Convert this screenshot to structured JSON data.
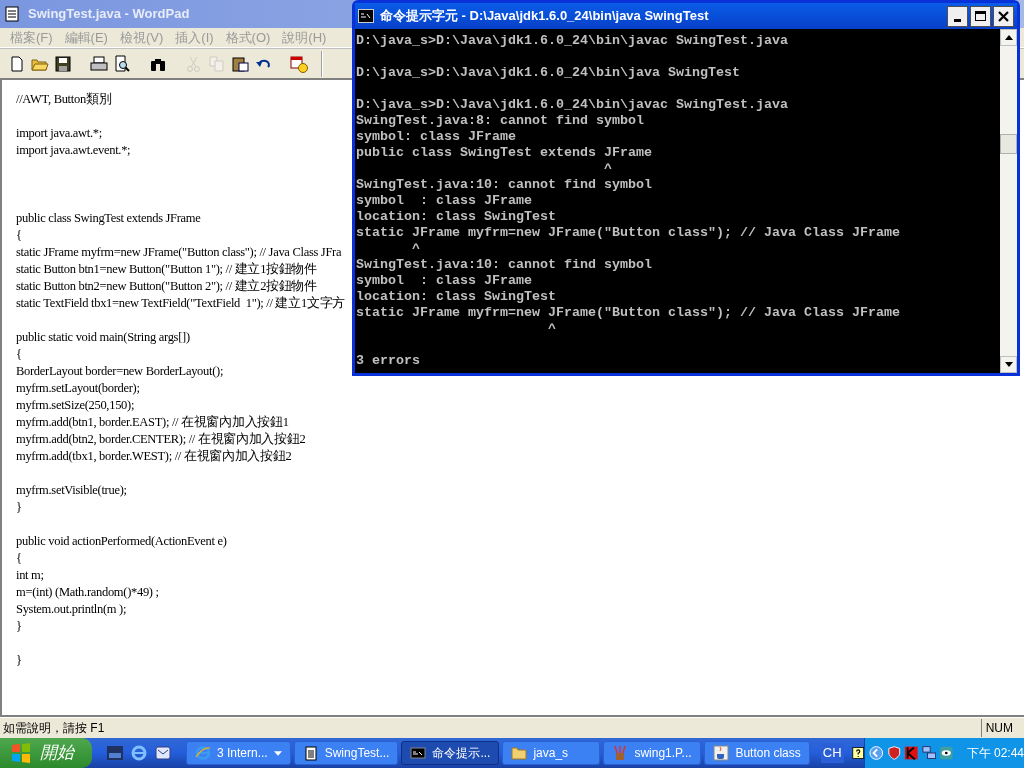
{
  "wordpad": {
    "title": "SwingTest.java - WordPad",
    "menu": [
      {
        "label": "檔案(F)",
        "disabled": true
      },
      {
        "label": "編輯(E)",
        "disabled": true
      },
      {
        "label": "檢視(V)",
        "disabled": true
      },
      {
        "label": "插入(I)",
        "disabled": true
      },
      {
        "label": "格式(O)",
        "disabled": true
      },
      {
        "label": "說明(H)",
        "disabled": true
      }
    ],
    "toolbar": [
      {
        "kind": "new",
        "disabled": false
      },
      {
        "kind": "open",
        "disabled": false
      },
      {
        "kind": "save",
        "disabled": false
      },
      {
        "kind": "separator"
      },
      {
        "kind": "print",
        "disabled": false
      },
      {
        "kind": "preview",
        "disabled": false
      },
      {
        "kind": "separator"
      },
      {
        "kind": "find",
        "disabled": false
      },
      {
        "kind": "separator"
      },
      {
        "kind": "cut",
        "disabled": true
      },
      {
        "kind": "copy",
        "disabled": true
      },
      {
        "kind": "paste",
        "disabled": false
      },
      {
        "kind": "undo",
        "disabled": false
      },
      {
        "kind": "separator"
      },
      {
        "kind": "datetime",
        "disabled": false
      }
    ],
    "lines": [
      {
        "kind": "code",
        "text": "//AWT, Button類別"
      },
      {
        "kind": "blank"
      },
      {
        "kind": "code",
        "text": "import java.awt.*;"
      },
      {
        "kind": "code",
        "text": "import java.awt.event.*;"
      },
      {
        "kind": "blank"
      },
      {
        "kind": "blank"
      },
      {
        "kind": "blank"
      },
      {
        "kind": "code",
        "text": "public class SwingTest extends JFrame"
      },
      {
        "kind": "code",
        "text": "{"
      },
      {
        "kind": "code",
        "text": "static JFrame myfrm=new JFrame(\"Button class\"); // Java Class JFra"
      },
      {
        "kind": "code",
        "text": "static Button btn1=new Button(\"Button 1\"); // 建立1按鈕物件"
      },
      {
        "kind": "code",
        "text": "static Button btn2=new Button(\"Button 2\"); // 建立2按鈕物件"
      },
      {
        "kind": "code",
        "text": "static TextField tbx1=new TextField(\"TextField  1\"); // 建立1文字方"
      },
      {
        "kind": "blank"
      },
      {
        "kind": "code",
        "text": "public static void main(String args[])"
      },
      {
        "kind": "code",
        "text": "{"
      },
      {
        "kind": "code",
        "text": "BorderLayout border=new BorderLayout();"
      },
      {
        "kind": "code",
        "text": "myfrm.setLayout(border);"
      },
      {
        "kind": "code",
        "text": "myfrm.setSize(250,150);"
      },
      {
        "kind": "code",
        "text": "myfrm.add(btn1, border.EAST); // 在視窗內加入按鈕1"
      },
      {
        "kind": "code",
        "text": "myfrm.add(btn2, border.CENTER); // 在視窗內加入按鈕2"
      },
      {
        "kind": "code",
        "text": "myfrm.add(tbx1, border.WEST); // 在視窗內加入按鈕2"
      },
      {
        "kind": "blank"
      },
      {
        "kind": "code",
        "text": "myfrm.setVisible(true);"
      },
      {
        "kind": "code",
        "text": "}"
      },
      {
        "kind": "blank"
      },
      {
        "kind": "code",
        "text": "public void actionPerformed(ActionEvent e)"
      },
      {
        "kind": "code",
        "text": "{"
      },
      {
        "kind": "code",
        "text": "int m;"
      },
      {
        "kind": "code",
        "text": "m=(int) (Math.random()*49) ;"
      },
      {
        "kind": "code",
        "text": "System.out.println(m );"
      },
      {
        "kind": "code",
        "text": "}"
      },
      {
        "kind": "blank"
      },
      {
        "kind": "code",
        "text": "}"
      }
    ],
    "status": "如需說明，請按 F1",
    "indicator": "NUM"
  },
  "console": {
    "title": "命令提示字元 - D:\\Java\\jdk1.6.0_24\\bin\\java SwingTest",
    "lines": [
      {
        "kind": "text",
        "text": "D:\\java_s>D:\\Java\\jdk1.6.0_24\\bin\\javac SwingTest.java"
      },
      {
        "kind": "blank"
      },
      {
        "kind": "text",
        "text": "D:\\java_s>D:\\Java\\jdk1.6.0_24\\bin\\java SwingTest"
      },
      {
        "kind": "blank"
      },
      {
        "kind": "text",
        "text": "D:\\java_s>D:\\Java\\jdk1.6.0_24\\bin\\javac SwingTest.java"
      },
      {
        "kind": "text",
        "text": "SwingTest.java:8: cannot find symbol"
      },
      {
        "kind": "text",
        "text": "symbol: class JFrame"
      },
      {
        "kind": "text",
        "text": "public class SwingTest extends JFrame"
      },
      {
        "kind": "text",
        "text": "                               ^"
      },
      {
        "kind": "text",
        "text": "SwingTest.java:10: cannot find symbol"
      },
      {
        "kind": "text",
        "text": "symbol  : class JFrame"
      },
      {
        "kind": "text",
        "text": "location: class SwingTest"
      },
      {
        "kind": "text",
        "text": "static JFrame myfrm=new JFrame(\"Button class\"); // Java Class JFrame"
      },
      {
        "kind": "text",
        "text": "       ^"
      },
      {
        "kind": "text",
        "text": "SwingTest.java:10: cannot find symbol"
      },
      {
        "kind": "text",
        "text": "symbol  : class JFrame"
      },
      {
        "kind": "text",
        "text": "location: class SwingTest"
      },
      {
        "kind": "text",
        "text": "static JFrame myfrm=new JFrame(\"Button class\"); // Java Class JFrame"
      },
      {
        "kind": "text",
        "text": "                        ^"
      },
      {
        "kind": "blank"
      },
      {
        "kind": "text",
        "text": "3 errors"
      }
    ]
  },
  "taskbar": {
    "start": "開始",
    "tasks": [
      {
        "kind": "browser",
        "label": "3 Intern...",
        "selected": false,
        "group": true
      },
      {
        "kind": "notepad",
        "label": "SwingTest...",
        "selected": false,
        "group": false
      },
      {
        "kind": "console",
        "label": "命令提示...",
        "selected": true,
        "group": false
      },
      {
        "kind": "folder",
        "label": "java_s",
        "selected": false,
        "group": false
      },
      {
        "kind": "paint",
        "label": "swing1.P...",
        "selected": false,
        "group": false
      },
      {
        "kind": "java",
        "label": "Button class",
        "selected": false,
        "group": false
      }
    ],
    "language": "CH",
    "clock": "下午 02:44"
  }
}
